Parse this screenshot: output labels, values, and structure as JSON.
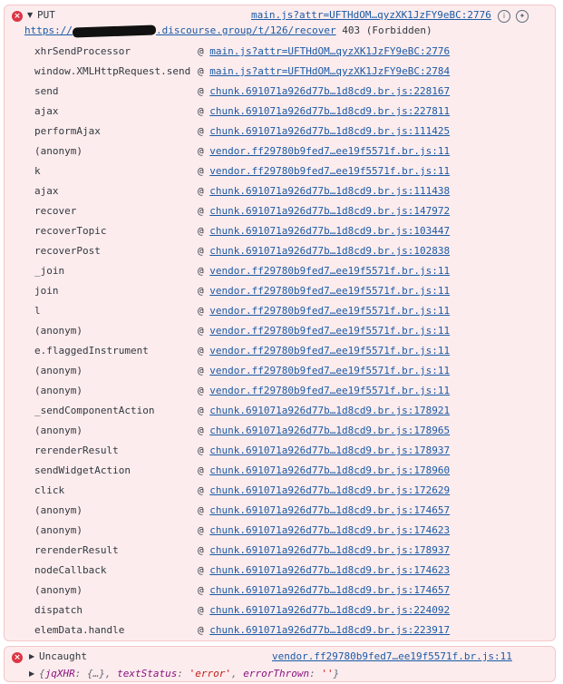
{
  "error1": {
    "method": "PUT",
    "source_link": "main.js?attr=UFTHdOM…qyzXK1JzFY9eBC:2776",
    "url_prefix": "https://",
    "url_rest": ".discourse.group/t/126/recover",
    "status": "403 (Forbidden)",
    "stack": [
      {
        "fn": "xhrSendProcessor",
        "link": "main.js?attr=UFTHdOM…qyzXK1JzFY9eBC:2776"
      },
      {
        "fn": "window.XMLHttpRequest.send",
        "link": "main.js?attr=UFTHdOM…qyzXK1JzFY9eBC:2784"
      },
      {
        "fn": "send",
        "link": "chunk.691071a926d77b…1d8cd9.br.js:228167"
      },
      {
        "fn": "ajax",
        "link": "chunk.691071a926d77b…1d8cd9.br.js:227811"
      },
      {
        "fn": "performAjax",
        "link": "chunk.691071a926d77b…1d8cd9.br.js:111425"
      },
      {
        "fn": "(anonym)",
        "link": "vendor.ff29780b9fed7…ee19f5571f.br.js:11"
      },
      {
        "fn": "k",
        "link": "vendor.ff29780b9fed7…ee19f5571f.br.js:11"
      },
      {
        "fn": "ajax",
        "link": "chunk.691071a926d77b…1d8cd9.br.js:111438"
      },
      {
        "fn": "recover",
        "link": "chunk.691071a926d77b…1d8cd9.br.js:147972"
      },
      {
        "fn": "recoverTopic",
        "link": "chunk.691071a926d77b…1d8cd9.br.js:103447"
      },
      {
        "fn": "recoverPost",
        "link": "chunk.691071a926d77b…1d8cd9.br.js:102838"
      },
      {
        "fn": "_join",
        "link": "vendor.ff29780b9fed7…ee19f5571f.br.js:11"
      },
      {
        "fn": "join",
        "link": "vendor.ff29780b9fed7…ee19f5571f.br.js:11"
      },
      {
        "fn": "l",
        "link": "vendor.ff29780b9fed7…ee19f5571f.br.js:11"
      },
      {
        "fn": "(anonym)",
        "link": "vendor.ff29780b9fed7…ee19f5571f.br.js:11"
      },
      {
        "fn": "e.flaggedInstrument",
        "link": "vendor.ff29780b9fed7…ee19f5571f.br.js:11"
      },
      {
        "fn": "(anonym)",
        "link": "vendor.ff29780b9fed7…ee19f5571f.br.js:11"
      },
      {
        "fn": "(anonym)",
        "link": "vendor.ff29780b9fed7…ee19f5571f.br.js:11"
      },
      {
        "fn": "_sendComponentAction",
        "link": "chunk.691071a926d77b…1d8cd9.br.js:178921"
      },
      {
        "fn": "(anonym)",
        "link": "chunk.691071a926d77b…1d8cd9.br.js:178965"
      },
      {
        "fn": "rerenderResult",
        "link": "chunk.691071a926d77b…1d8cd9.br.js:178937"
      },
      {
        "fn": "sendWidgetAction",
        "link": "chunk.691071a926d77b…1d8cd9.br.js:178960"
      },
      {
        "fn": "click",
        "link": "chunk.691071a926d77b…1d8cd9.br.js:172629"
      },
      {
        "fn": "(anonym)",
        "link": "chunk.691071a926d77b…1d8cd9.br.js:174657"
      },
      {
        "fn": "(anonym)",
        "link": "chunk.691071a926d77b…1d8cd9.br.js:174623"
      },
      {
        "fn": "rerenderResult",
        "link": "chunk.691071a926d77b…1d8cd9.br.js:178937"
      },
      {
        "fn": "nodeCallback",
        "link": "chunk.691071a926d77b…1d8cd9.br.js:174623"
      },
      {
        "fn": "(anonym)",
        "link": "chunk.691071a926d77b…1d8cd9.br.js:174657"
      },
      {
        "fn": "dispatch",
        "link": "chunk.691071a926d77b…1d8cd9.br.js:224092"
      },
      {
        "fn": "elemData.handle",
        "link": "chunk.691071a926d77b…1d8cd9.br.js:223917"
      }
    ]
  },
  "error2": {
    "label": "Uncaught",
    "source_link": "vendor.ff29780b9fed7…ee19f5571f.br.js:11",
    "obj_open": "{",
    "k1": "jqXHR",
    "v1": "{…}",
    "k2": "textStatus",
    "v2": "'error'",
    "k3": "errorThrown",
    "v3": "''",
    "obj_close": "}"
  },
  "glyphs": {
    "error_icon": "×",
    "expanded": "▼",
    "collapsed": "▶",
    "at": "@",
    "info": "i"
  },
  "colors": {
    "error_bg": "#fdeced",
    "error_border": "#f3c7c9",
    "link": "#1a5aa6",
    "error_icon": "#dc3545"
  }
}
